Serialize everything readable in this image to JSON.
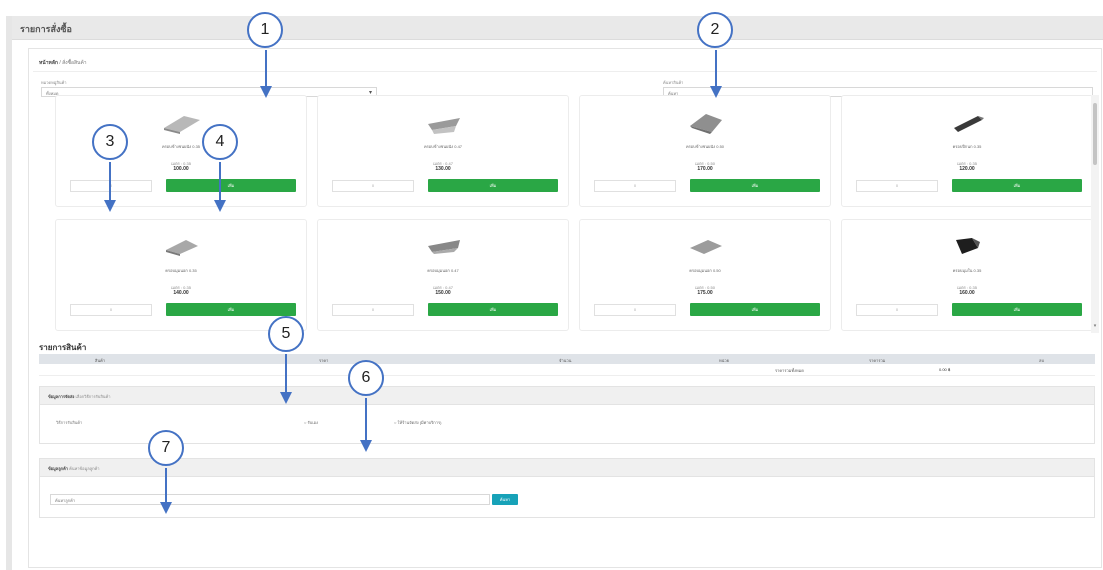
{
  "page": {
    "title": "รายการสั่งซื้อ"
  },
  "breadcrumb": {
    "root": "หน้าหลัก",
    "separator": "/",
    "current": "สั่งซื้อสินค้า"
  },
  "filters": {
    "category_label": "หมวดหมู่สินค้า",
    "category_value": "ทั้งหมด",
    "search_label": "ค้นหาสินค้า",
    "search_placeholder": "ค้นหา"
  },
  "products": [
    {
      "name": "ครอบข้างชนผนัง 0.35",
      "unit": "เมตร : 0.35",
      "price": "100.00",
      "qty": "0",
      "add_label": "เพิ่ม"
    },
    {
      "name": "ครอบข้างชนผนัง 0.47",
      "unit": "เมตร : 0.47",
      "price": "130.00",
      "qty": "0",
      "add_label": "เพิ่ม"
    },
    {
      "name": "ครอบข้างชนผนัง 0.50",
      "unit": "เมตร : 0.50",
      "price": "170.00",
      "qty": "0",
      "add_label": "เพิ่ม"
    },
    {
      "name": "ครอบปีกนก 0.35",
      "unit": "เมตร : 0.35",
      "price": "120.00",
      "qty": "0",
      "add_label": "เพิ่ม"
    },
    {
      "name": "ครอบมุมนอก 0.35",
      "unit": "เมตร : 0.35",
      "price": "140.00",
      "qty": "0",
      "add_label": "เพิ่ม"
    },
    {
      "name": "ครอบมุมนอก 0.47",
      "unit": "เมตร : 0.47",
      "price": "150.00",
      "qty": "0",
      "add_label": "เพิ่ม"
    },
    {
      "name": "ครอบมุมนอก 0.50",
      "unit": "เมตร : 0.50",
      "price": "175.00",
      "qty": "0",
      "add_label": "เพิ่ม"
    },
    {
      "name": "ครอบมุมใน 0.35",
      "unit": "เมตร : 0.35",
      "price": "160.00",
      "qty": "0",
      "add_label": "เพิ่ม"
    }
  ],
  "cart": {
    "title": "รายการสินค้า",
    "headers": [
      "สินค้า",
      "ราคา",
      "จำนวน",
      "หน่วย",
      "ราคารวม",
      "ลบ"
    ],
    "total_label": "ราคารวมทั้งหมด",
    "total_value": "0.00 ฿"
  },
  "delivery": {
    "title": "ข้อมูลการจัดส่ง",
    "hint": "เลือกวิธีการรับสินค้า",
    "field_label": "วิธีการรับสินค้า",
    "option_1": "รับเอง",
    "option_2": "ให้ร้านจัดส่ง (มีค่าบริการ)"
  },
  "customer": {
    "title": "ข้อมูลลูกค้า",
    "hint": "ค้นหาข้อมูลลูกค้า",
    "placeholder": "ค้นหาลูกค้า",
    "search_label": "ค้นหา"
  },
  "callouts": [
    "1",
    "2",
    "3",
    "4",
    "5",
    "6",
    "7"
  ],
  "colors": {
    "add_button": "#2aa745",
    "search_button": "#17a2b8",
    "callout_border": "#4472c4",
    "header_bg": "#e9e9e9"
  }
}
